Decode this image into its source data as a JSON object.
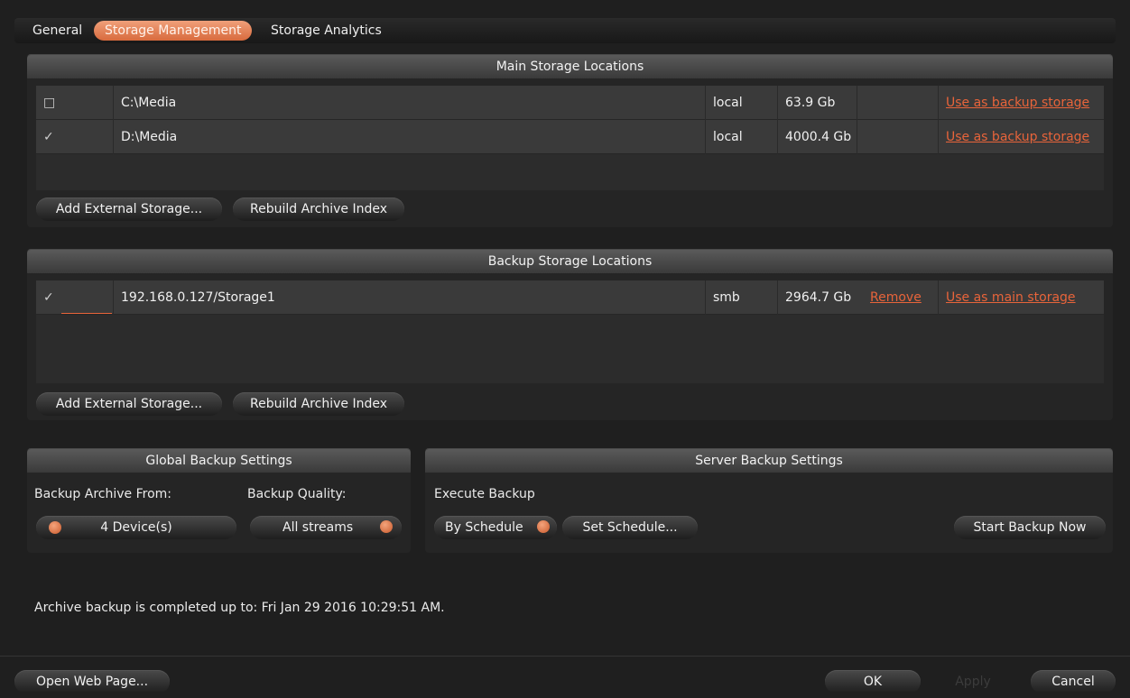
{
  "tabs": [
    {
      "label": "General"
    },
    {
      "label": "Storage Management"
    },
    {
      "label": "Storage Analytics"
    }
  ],
  "main_storage": {
    "title": "Main Storage Locations",
    "rows": [
      {
        "checked": "□",
        "path": "C:\\Media",
        "type": "local",
        "size": "63.9 Gb",
        "action1": "",
        "action2": "Use as backup storage"
      },
      {
        "checked": "✓",
        "path": "D:\\Media",
        "type": "local",
        "size": "4000.4 Gb",
        "action1": "",
        "action2": "Use as backup storage"
      }
    ],
    "add_button": "Add External Storage...",
    "rebuild_button": "Rebuild Archive Index"
  },
  "backup_storage": {
    "title": "Backup Storage Locations",
    "rows": [
      {
        "checked": "✓",
        "path": "192.168.0.127/Storage1",
        "type": "smb",
        "size": "2964.7 Gb",
        "action1": "Remove",
        "action2": "Use as main storage"
      }
    ],
    "add_button": "Add External Storage...",
    "rebuild_button": "Rebuild Archive Index"
  },
  "global_backup": {
    "title": "Global Backup Settings",
    "archive_from_label": "Backup Archive From:",
    "quality_label": "Backup Quality:",
    "devices_value": "4 Device(s)",
    "quality_value": "All streams"
  },
  "server_backup": {
    "title": "Server Backup Settings",
    "execute_label": "Execute Backup",
    "schedule_value": "By Schedule",
    "set_schedule_button": "Set Schedule...",
    "start_now_button": "Start Backup Now"
  },
  "status_text": "Archive backup is completed up to: Fri Jan 29 2016 10:29:51 AM.",
  "footer": {
    "open_web_page": "Open Web Page...",
    "ok": "OK",
    "apply": "Apply",
    "cancel": "Cancel"
  },
  "colors": {
    "accent": "#e8643a",
    "background": "#1f1f1f"
  }
}
